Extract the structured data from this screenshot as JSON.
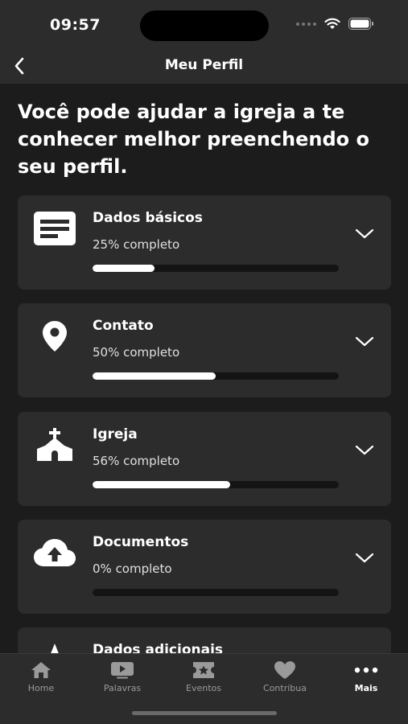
{
  "status_bar": {
    "time": "09:57"
  },
  "nav": {
    "title": "Meu Perfil",
    "back_icon": "chevron-left-icon"
  },
  "intro": "Você pode ajudar a igreja a te conhecer melhor preenchendo o seu perfil.",
  "sections": [
    {
      "title": "Dados básicos",
      "status": "25% completo",
      "progress": 0.25,
      "icon": "document-icon"
    },
    {
      "title": "Contato",
      "status": "50% completo",
      "progress": 0.5,
      "icon": "location-pin-icon"
    },
    {
      "title": "Igreja",
      "status": "56% completo",
      "progress": 0.56,
      "icon": "church-icon"
    },
    {
      "title": "Documentos",
      "status": "0% completo",
      "progress": 0.0,
      "icon": "cloud-upload-icon"
    },
    {
      "title": "Dados adicionais",
      "icon": "star-icon"
    }
  ],
  "tabs": [
    {
      "label": "Home",
      "icon": "home-icon",
      "active": false
    },
    {
      "label": "Palavras",
      "icon": "video-icon",
      "active": false
    },
    {
      "label": "Eventos",
      "icon": "ticket-icon",
      "active": false
    },
    {
      "label": "Contribua",
      "icon": "heart-icon",
      "active": false
    },
    {
      "label": "Mais",
      "icon": "more-icon",
      "active": true
    }
  ],
  "colors": {
    "background": "#1c1c1c",
    "surface": "#2c2c2c",
    "track": "#141414",
    "fill": "#ffffff",
    "inactive_tab": "#9a9a9a"
  }
}
